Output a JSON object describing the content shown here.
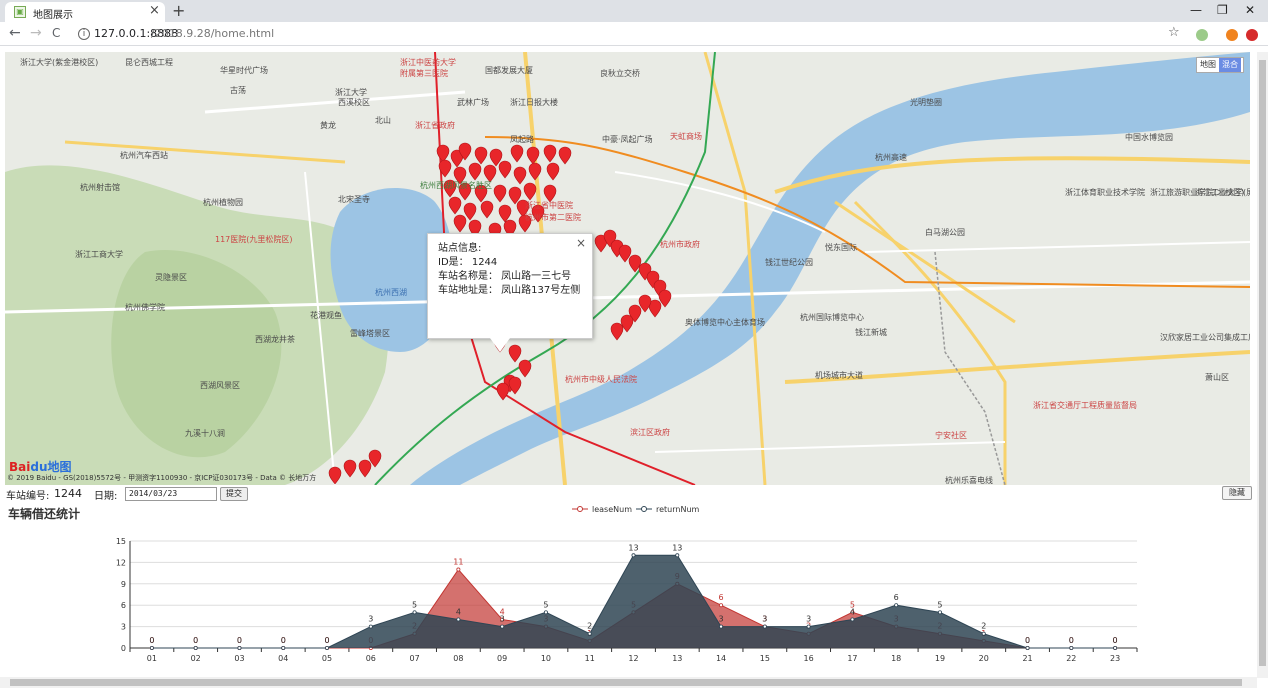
{
  "browser": {
    "tab_title": "地图展示",
    "tab_favicon": "map-favicon",
    "url_host": "127.0.0.1:8888",
    "url_path": "/2018.9.28/home.html",
    "new_tab": "+",
    "minimize": "—",
    "restore": "❐",
    "close": "✕",
    "tab_close": "×",
    "back": "←",
    "forward": "→",
    "reload": "C",
    "star": "☆"
  },
  "map": {
    "type_options": [
      "地图",
      "混合"
    ],
    "selected_type": "混合",
    "labels": [
      {
        "t": "昆仑西城工程",
        "c": ""
      },
      {
        "t": "浙江中医药大学",
        "c": "red"
      },
      {
        "t": "附属第三医院",
        "c": "red"
      },
      {
        "t": "国都发展大厦",
        "c": ""
      },
      {
        "t": "良秋立交桥",
        "c": ""
      },
      {
        "t": "华星时代广场",
        "c": ""
      },
      {
        "t": "古荡",
        "c": ""
      },
      {
        "t": "浙江大学",
        "c": ""
      },
      {
        "t": "西溪校区",
        "c": ""
      },
      {
        "t": "黄龙",
        "c": ""
      },
      {
        "t": "北山",
        "c": ""
      },
      {
        "t": "武林广场",
        "c": ""
      },
      {
        "t": "浙江日报大楼",
        "c": ""
      },
      {
        "t": "浙江省政府",
        "c": "red"
      },
      {
        "t": "凤起路",
        "c": ""
      },
      {
        "t": "中豪·凤起广场",
        "c": ""
      },
      {
        "t": "天虹商场",
        "c": "red"
      },
      {
        "t": "杭州汽车西站",
        "c": ""
      },
      {
        "t": "杭州射击馆",
        "c": ""
      },
      {
        "t": "杭州植物园",
        "c": ""
      },
      {
        "t": "北宋圣寺",
        "c": ""
      },
      {
        "t": "杭州西湖风景名胜区",
        "c": "green"
      },
      {
        "t": "浙江省中医院",
        "c": "red"
      },
      {
        "t": "杭州市第二医院",
        "c": "red"
      },
      {
        "t": "杭州市政府",
        "c": "red"
      },
      {
        "t": "浙江工商大学",
        "c": ""
      },
      {
        "t": "灵隐景区",
        "c": ""
      },
      {
        "t": "杭州佛学院",
        "c": ""
      },
      {
        "t": "117医院(九里松院区)",
        "c": "red"
      },
      {
        "t": "杭州西湖",
        "c": "blue"
      },
      {
        "t": "雷峰塔景区",
        "c": ""
      },
      {
        "t": "西湖龙井茶",
        "c": ""
      },
      {
        "t": "花港观鱼",
        "c": ""
      },
      {
        "t": "钱江世纪公园",
        "c": ""
      },
      {
        "t": "悦东国际",
        "c": ""
      },
      {
        "t": "杭州国际博览中心",
        "c": ""
      },
      {
        "t": "奥体博览中心主体育场",
        "c": ""
      },
      {
        "t": "机场城市大道",
        "c": ""
      },
      {
        "t": "钱江新城",
        "c": ""
      },
      {
        "t": "滨江区政府",
        "c": "red"
      },
      {
        "t": "杭州市中级人民法院",
        "c": "red"
      },
      {
        "t": "西湖风景区",
        "c": ""
      },
      {
        "t": "九溪十八涧",
        "c": ""
      },
      {
        "t": "浙江大学(紫金港校区)",
        "c": ""
      },
      {
        "t": "杭州高速",
        "c": ""
      },
      {
        "t": "萧山区",
        "c": ""
      },
      {
        "t": "浙江体育职业技术学院",
        "c": ""
      },
      {
        "t": "浙江旅游职业学院(北校区)",
        "c": ""
      },
      {
        "t": "浙江省交通厅工程质量监督局",
        "c": "red"
      },
      {
        "t": "宁安社区",
        "c": "red"
      },
      {
        "t": "杭州乐喜电线",
        "c": ""
      },
      {
        "t": "中国水博览园",
        "c": ""
      },
      {
        "t": "汉欣家居工业公司集成工厂",
        "c": ""
      },
      {
        "t": "光明垫圈",
        "c": ""
      },
      {
        "t": "浙江工业大学(屏峰校区)",
        "c": ""
      },
      {
        "t": "白马湖公园",
        "c": ""
      }
    ],
    "logo": "Bai",
    "logo_paw": "du",
    "logo_text": "地图",
    "copyright": "© 2019 Baidu - GS(2018)5572号 - 甲测资字1100930 - 京ICP证030173号 - Data © 长地万方"
  },
  "popup": {
    "title": "站点信息:",
    "id_line": "ID是：  1244",
    "name_line": "车站名称是：  凤山路一三七号",
    "addr_line": "车站地址是：  凤山路137号左侧",
    "close": "×"
  },
  "controls": {
    "station_label": "车站编号:",
    "station_id": "1244",
    "date_label": "日期:",
    "date_value": "2014/03/23",
    "submit": "提交",
    "hide": "隐藏"
  },
  "chart_title": "车辆借还统计",
  "colors": {
    "lease": "#c23531",
    "return": "#2f4554"
  },
  "chart_data": {
    "type": "area",
    "categories": [
      "01",
      "02",
      "03",
      "04",
      "05",
      "06",
      "07",
      "08",
      "09",
      "10",
      "11",
      "12",
      "13",
      "14",
      "15",
      "16",
      "17",
      "18",
      "19",
      "20",
      "21",
      "22",
      "23"
    ],
    "series": [
      {
        "name": "leaseNum",
        "values": [
          0,
          0,
          0,
          0,
          0,
          0,
          2,
          11,
          4,
          3,
          1,
          5,
          9,
          6,
          3,
          2,
          5,
          3,
          2,
          1,
          0,
          0,
          0
        ]
      },
      {
        "name": "returnNum",
        "values": [
          0,
          0,
          0,
          0,
          0,
          3,
          5,
          4,
          3,
          5,
          2,
          13,
          13,
          3,
          3,
          3,
          4,
          6,
          5,
          2,
          0,
          0,
          0
        ]
      }
    ],
    "ylim": [
      0,
      15
    ],
    "yticks": [
      0,
      3,
      6,
      9,
      12,
      15
    ],
    "legend": "top-center",
    "grid": true
  }
}
